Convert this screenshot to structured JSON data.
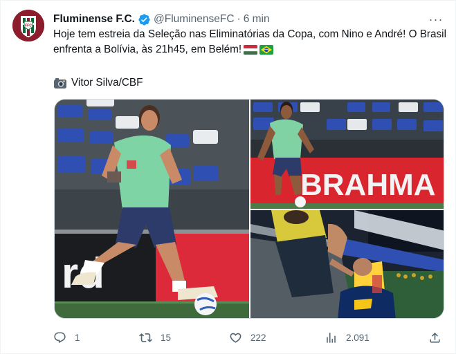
{
  "author": {
    "name": "Fluminense F.C.",
    "handle": "@FluminenseFC",
    "separator": "·",
    "time": "6 min",
    "verified": true
  },
  "tweet": {
    "text": "Hoje tem estreia da Seleção nas Eliminatórias da Copa, com Nino e André! O Brasil enfrenta a Bolívia, às 21h45, em Belém!",
    "flags": [
      "hungary-flag-icon",
      "brazil-flag-icon"
    ],
    "credit": "Vitor Silva/CBF"
  },
  "media": {
    "photos": [
      {
        "name": "photo-nino-training",
        "banner": "rd"
      },
      {
        "name": "photo-andre-training",
        "banner": "BRAHMA"
      },
      {
        "name": "photo-fans-stands"
      }
    ]
  },
  "actions": {
    "replies": "1",
    "retweets": "15",
    "likes": "222",
    "views": "2.091"
  },
  "colors": {
    "text": "#0f1419",
    "secondary": "#536471",
    "verified": "#1d9bf0",
    "border": "#cfd9de"
  }
}
